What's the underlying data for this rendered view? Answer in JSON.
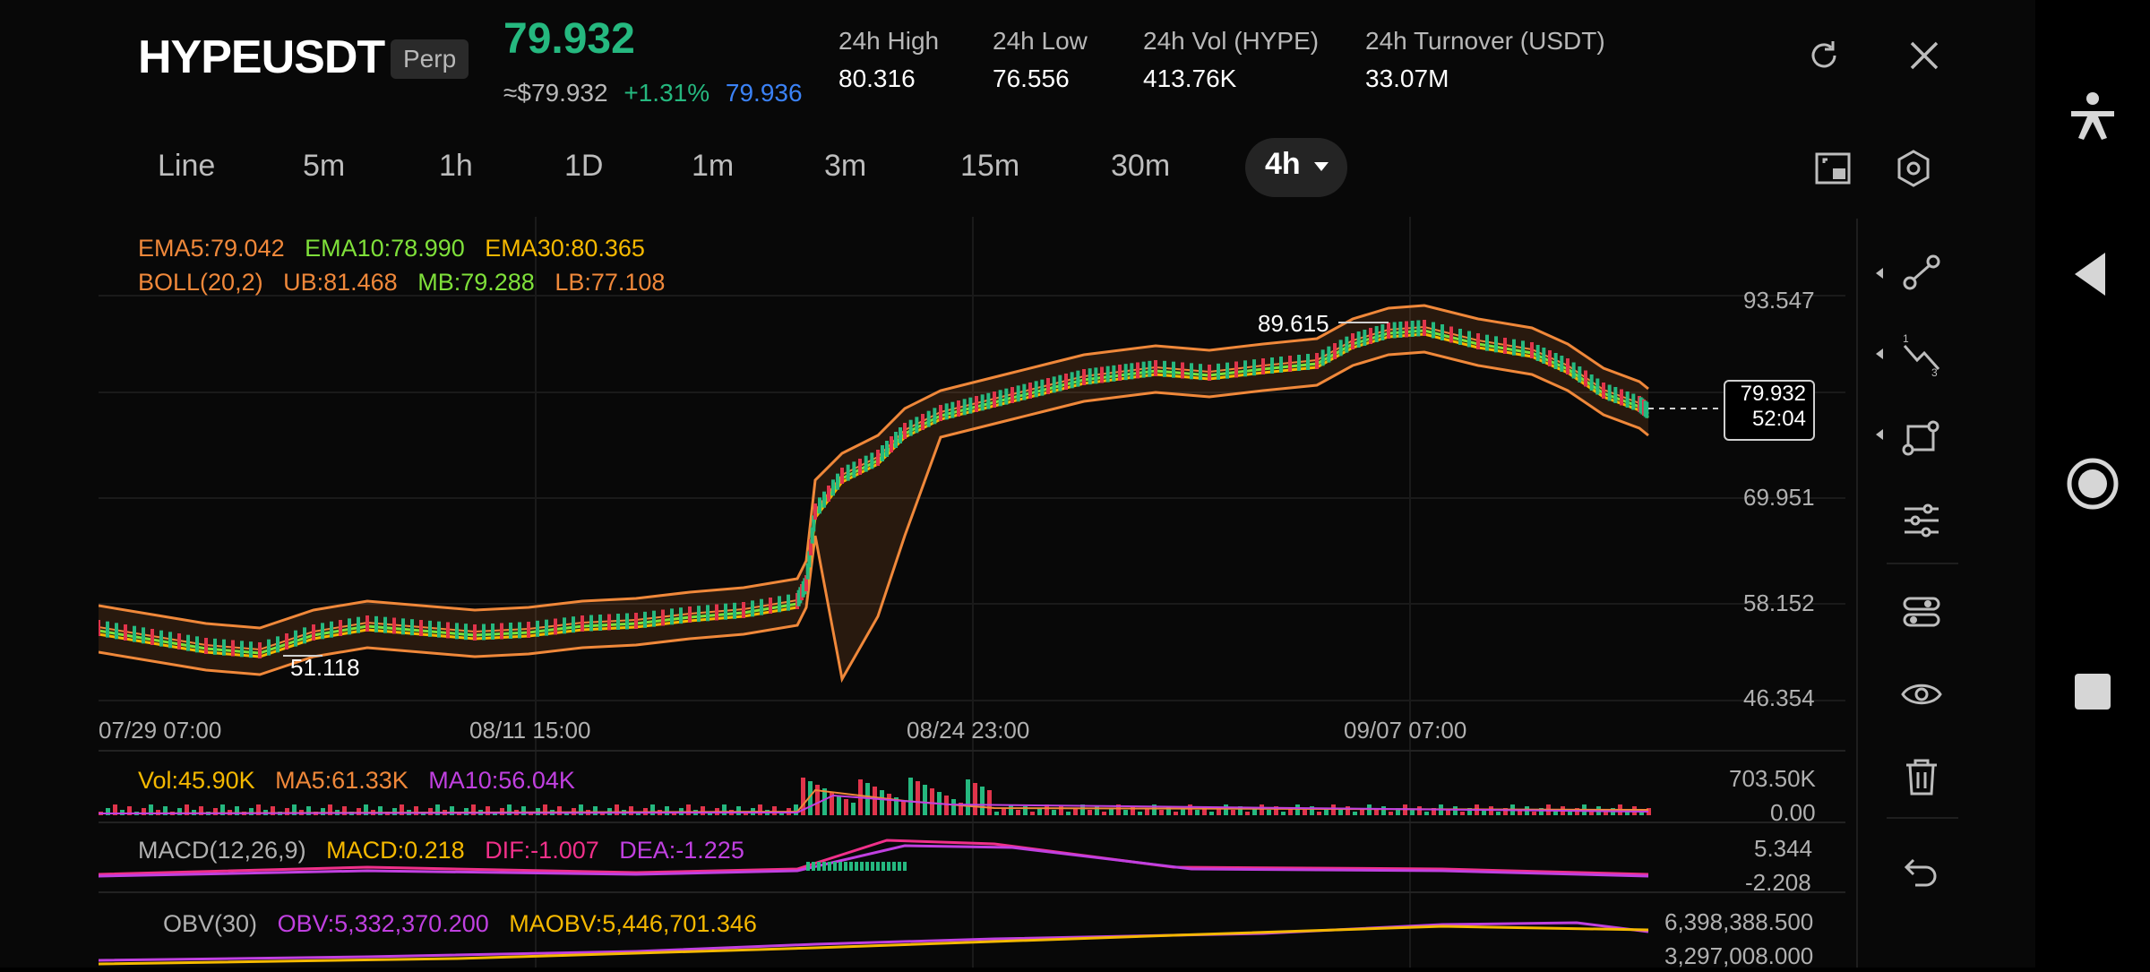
{
  "header": {
    "symbol": "HYPEUSDT",
    "contract_type": "Perp",
    "last_price": "79.932",
    "price_usd": "≈$79.932",
    "change_pct": "+1.31%",
    "mark_price": "79.936",
    "stats": [
      {
        "label": "24h   High",
        "value": "80.316"
      },
      {
        "label": "24h   Low",
        "value": "76.556"
      },
      {
        "label": "24h   Vol (HYPE)",
        "value": "413.76K"
      },
      {
        "label": "24h   Turnover (USDT)",
        "value": "33.07M"
      }
    ],
    "icons": [
      "refresh-icon",
      "close-icon"
    ]
  },
  "timeframes": [
    "Line",
    "5m",
    "1h",
    "1D",
    "1m",
    "3m",
    "15m",
    "30m"
  ],
  "active_timeframe": "4h",
  "toolbar_icons": [
    "fullscreen-icon",
    "settings-hexagon-icon"
  ],
  "indicators": {
    "ema": [
      "EMA5:79.042",
      "EMA10:78.990",
      "EMA30:80.365"
    ],
    "boll": [
      "BOLL(20,2)",
      "UB:81.468",
      "MB:79.288",
      "LB:77.108"
    ]
  },
  "price_axis": [
    "93.547",
    "69.951",
    "58.152",
    "46.354"
  ],
  "annotations": {
    "high": "89.615",
    "low": "51.118"
  },
  "current_price_label": {
    "price": "79.932",
    "countdown": "52:04"
  },
  "date_axis": [
    "07/29 07:00",
    "08/11 15:00",
    "08/24 23:00",
    "09/07 07:00"
  ],
  "volume_panel": {
    "legend": [
      "Vol:45.90K",
      "MA5:61.33K",
      "MA10:56.04K"
    ],
    "axis": [
      "703.50K",
      "0.00"
    ]
  },
  "macd_panel": {
    "legend": [
      "MACD(12,26,9)",
      "MACD:0.218",
      "DIF:-1.007",
      "DEA:-1.225"
    ],
    "axis": [
      "5.344",
      "-2.208"
    ]
  },
  "obv_panel": {
    "legend": [
      "OBV(30)",
      "OBV:5,332,370.200",
      "MAOBV:5,446,701.346"
    ],
    "axis": [
      "6,398,388.500",
      "3,297,008.000"
    ]
  },
  "drawing_tools": [
    "trend-line-icon",
    "fib-icon",
    "shape-icon",
    "adjust-icon",
    "indicator-settings-icon",
    "visibility-eye-icon",
    "delete-trash-icon",
    "undo-icon"
  ],
  "system_nav": [
    "accessibility-icon",
    "back-triangle-icon",
    "home-circle-icon",
    "recent-square-icon"
  ],
  "colors": {
    "up": "#25b87f",
    "down": "#e0344b",
    "orange": "#f0883a",
    "green": "#7fe03a",
    "yellow": "#f5b800",
    "purple": "#c040e0",
    "pink": "#f0308a",
    "blue": "#3b82f6"
  }
}
